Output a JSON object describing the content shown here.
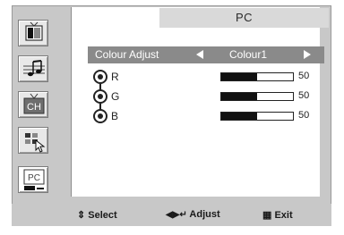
{
  "menu": {
    "title": "PC",
    "items": [
      {
        "icon": "picture-icon",
        "active": false
      },
      {
        "icon": "sound-icon",
        "active": false
      },
      {
        "icon": "channel-icon",
        "label": "CH",
        "active": false
      },
      {
        "icon": "setup-icon",
        "active": false
      },
      {
        "icon": "pc-icon",
        "label": "PC",
        "active": true
      }
    ]
  },
  "adjust": {
    "label": "Colour Adjust",
    "value": "Colour1"
  },
  "channels": [
    {
      "label": "R",
      "value": "50",
      "level": 0.5
    },
    {
      "label": "G",
      "value": "50",
      "level": 0.5
    },
    {
      "label": "B",
      "value": "50",
      "level": 0.5
    }
  ],
  "footer": {
    "select": "Select",
    "adjust": "Adjust",
    "exit": "Exit"
  },
  "colors": {
    "frame": "#c8c8c8",
    "highlight": "#8a8a8a",
    "title_bar": "#d9d9d9"
  }
}
